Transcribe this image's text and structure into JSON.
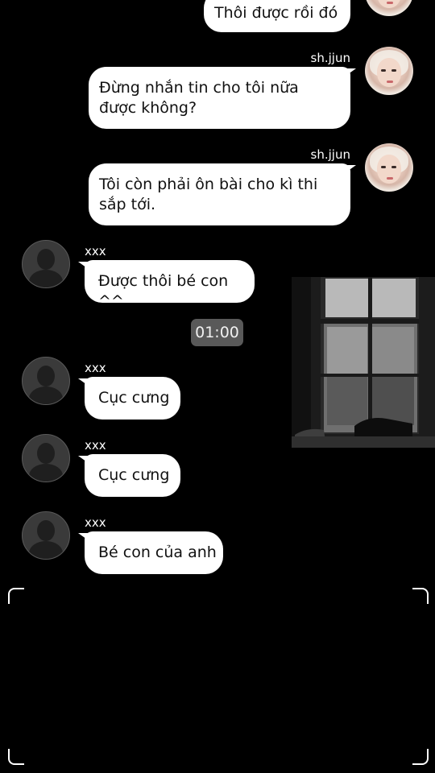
{
  "messages": {
    "m0": {
      "text": "Thôi được rồi đó"
    },
    "m1": {
      "sender": "sh.jjun",
      "text": "Đừng nhắn tin cho tôi nữa được không?"
    },
    "m2": {
      "sender": "sh.jjun",
      "text": " Tôi còn phải ôn bài cho kì thi sắp tới."
    },
    "m3": {
      "sender": "xxx",
      "text": "Được thôi bé con ^^"
    },
    "time": "01:00",
    "m4": {
      "sender": "xxx",
      "text": "Cục cưng"
    },
    "m5": {
      "sender": "xxx",
      "text": "Cục cưng"
    },
    "m6": {
      "sender": "xxx",
      "text": "Bé con của anh"
    }
  },
  "colors": {
    "background": "#000000",
    "bubble": "#ffffff",
    "time_chip": "#595959"
  },
  "icons": {
    "self_avatar": "profile-photo-avatar",
    "other_avatar": "default-person-avatar"
  }
}
